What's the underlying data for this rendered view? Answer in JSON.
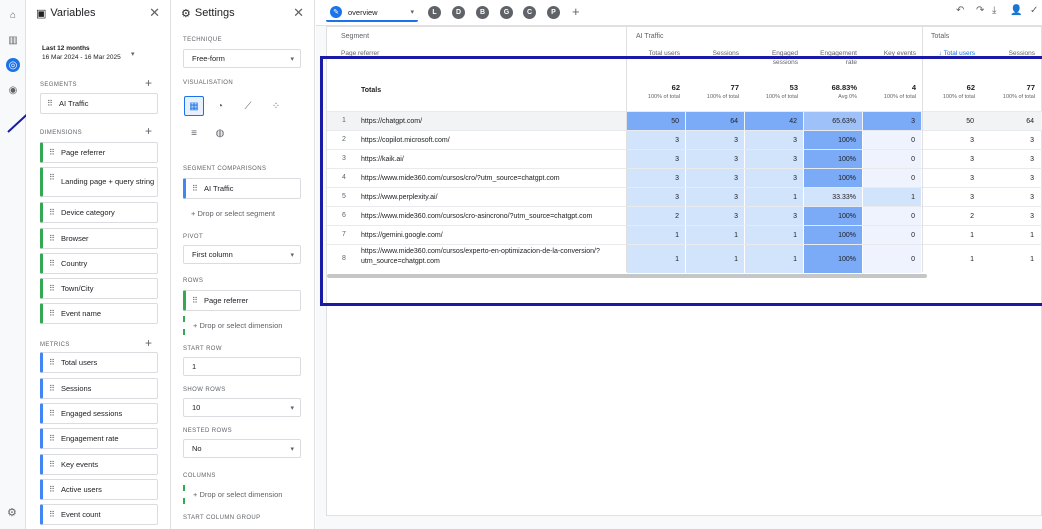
{
  "variables_panel": {
    "title": "Variables",
    "date_label": "Last 12 months",
    "date_range": "16 Mar 2024 - 16 Mar 2025",
    "segments_label": "SEGMENTS",
    "segments": [
      "AI Traffic"
    ],
    "dimensions_label": "DIMENSIONS",
    "dimensions": [
      "Page referrer",
      "Landing page + query string",
      "Device category",
      "Browser",
      "Country",
      "Town/City",
      "Event name"
    ],
    "metrics_label": "METRICS",
    "metrics": [
      "Total users",
      "Sessions",
      "Engaged sessions",
      "Engagement rate",
      "Key events",
      "Active users",
      "Event count"
    ]
  },
  "settings_panel": {
    "title": "Settings",
    "technique_label": "TECHNIQUE",
    "technique_value": "Free-form",
    "visualisation_label": "VISUALISATION",
    "segment_comparisons_label": "SEGMENT COMPARISONS",
    "segment_comparison_value": "AI Traffic",
    "drop_segment": "Drop or select segment",
    "pivot_label": "PIVOT",
    "pivot_value": "First column",
    "rows_label": "ROWS",
    "rows_value": "Page referrer",
    "drop_dimension": "Drop or select dimension",
    "start_row_label": "START ROW",
    "start_row_value": "1",
    "show_rows_label": "SHOW ROWS",
    "show_rows_value": "10",
    "nested_rows_label": "NESTED ROWS",
    "nested_rows_value": "No",
    "columns_label": "COLUMNS",
    "drop_dimension_columns": "Drop or select dimension",
    "start_column_group_label": "START COLUMN GROUP"
  },
  "tabs": {
    "active": "overview",
    "others": [
      "L",
      "D",
      "B",
      "G",
      "C",
      "P"
    ]
  },
  "table": {
    "segment_header": "Segment",
    "dimension_header": "Page referrer",
    "group1": "AI Traffic",
    "group2": "Totals",
    "columns": [
      {
        "label": "Total users",
        "sub": ""
      },
      {
        "label": "Sessions",
        "sub": ""
      },
      {
        "label": "Engaged",
        "sub": "sessions"
      },
      {
        "label": "Engagement",
        "sub": "rate"
      },
      {
        "label": "Key events",
        "sub": ""
      },
      {
        "label": "↓ Total users",
        "sub": ""
      },
      {
        "label": "Sessions",
        "sub": ""
      }
    ],
    "totals_label": "Totals",
    "totals": [
      {
        "v": "62",
        "s": "100% of total"
      },
      {
        "v": "77",
        "s": "100% of total"
      },
      {
        "v": "53",
        "s": "100% of total"
      },
      {
        "v": "68.83%",
        "s": "Avg 0%"
      },
      {
        "v": "4",
        "s": "100% of total"
      },
      {
        "v": "62",
        "s": "100% of total"
      },
      {
        "v": "77",
        "s": "100% of total"
      }
    ],
    "rows": [
      {
        "n": "1",
        "url": "https://chatgpt.com/",
        "vals": [
          "50",
          "64",
          "42",
          "65.63%",
          "3",
          "50",
          "64"
        ]
      },
      {
        "n": "2",
        "url": "https://copilot.microsoft.com/",
        "vals": [
          "3",
          "3",
          "3",
          "100%",
          "0",
          "3",
          "3"
        ]
      },
      {
        "n": "3",
        "url": "https://kaik.ai/",
        "vals": [
          "3",
          "3",
          "3",
          "100%",
          "0",
          "3",
          "3"
        ]
      },
      {
        "n": "4",
        "url": "https://www.mide360.com/cursos/cro/?utm_source=chatgpt.com",
        "vals": [
          "3",
          "3",
          "3",
          "100%",
          "0",
          "3",
          "3"
        ]
      },
      {
        "n": "5",
        "url": "https://www.perplexity.ai/",
        "vals": [
          "3",
          "3",
          "1",
          "33.33%",
          "1",
          "3",
          "3"
        ]
      },
      {
        "n": "6",
        "url": "https://www.mide360.com/cursos/cro-asincrono/?utm_source=chatgpt.com",
        "vals": [
          "2",
          "3",
          "3",
          "100%",
          "0",
          "2",
          "3"
        ]
      },
      {
        "n": "7",
        "url": "https://gemini.google.com/",
        "vals": [
          "1",
          "1",
          "1",
          "100%",
          "0",
          "1",
          "1"
        ]
      },
      {
        "n": "8",
        "url": "https://www.mide360.com/cursos/experto-en-optimizacion-de-la-conversion/?utm_source=chatgpt.com",
        "vals": [
          "1",
          "1",
          "1",
          "100%",
          "0",
          "1",
          "1"
        ]
      }
    ]
  },
  "colors": {
    "accent": "#1a73e8",
    "heat_strong": "#7baaf7",
    "heat_mid": "#9fc1f9",
    "heat_light": "#d2e3fc",
    "annotation": "#1a1aa6"
  }
}
